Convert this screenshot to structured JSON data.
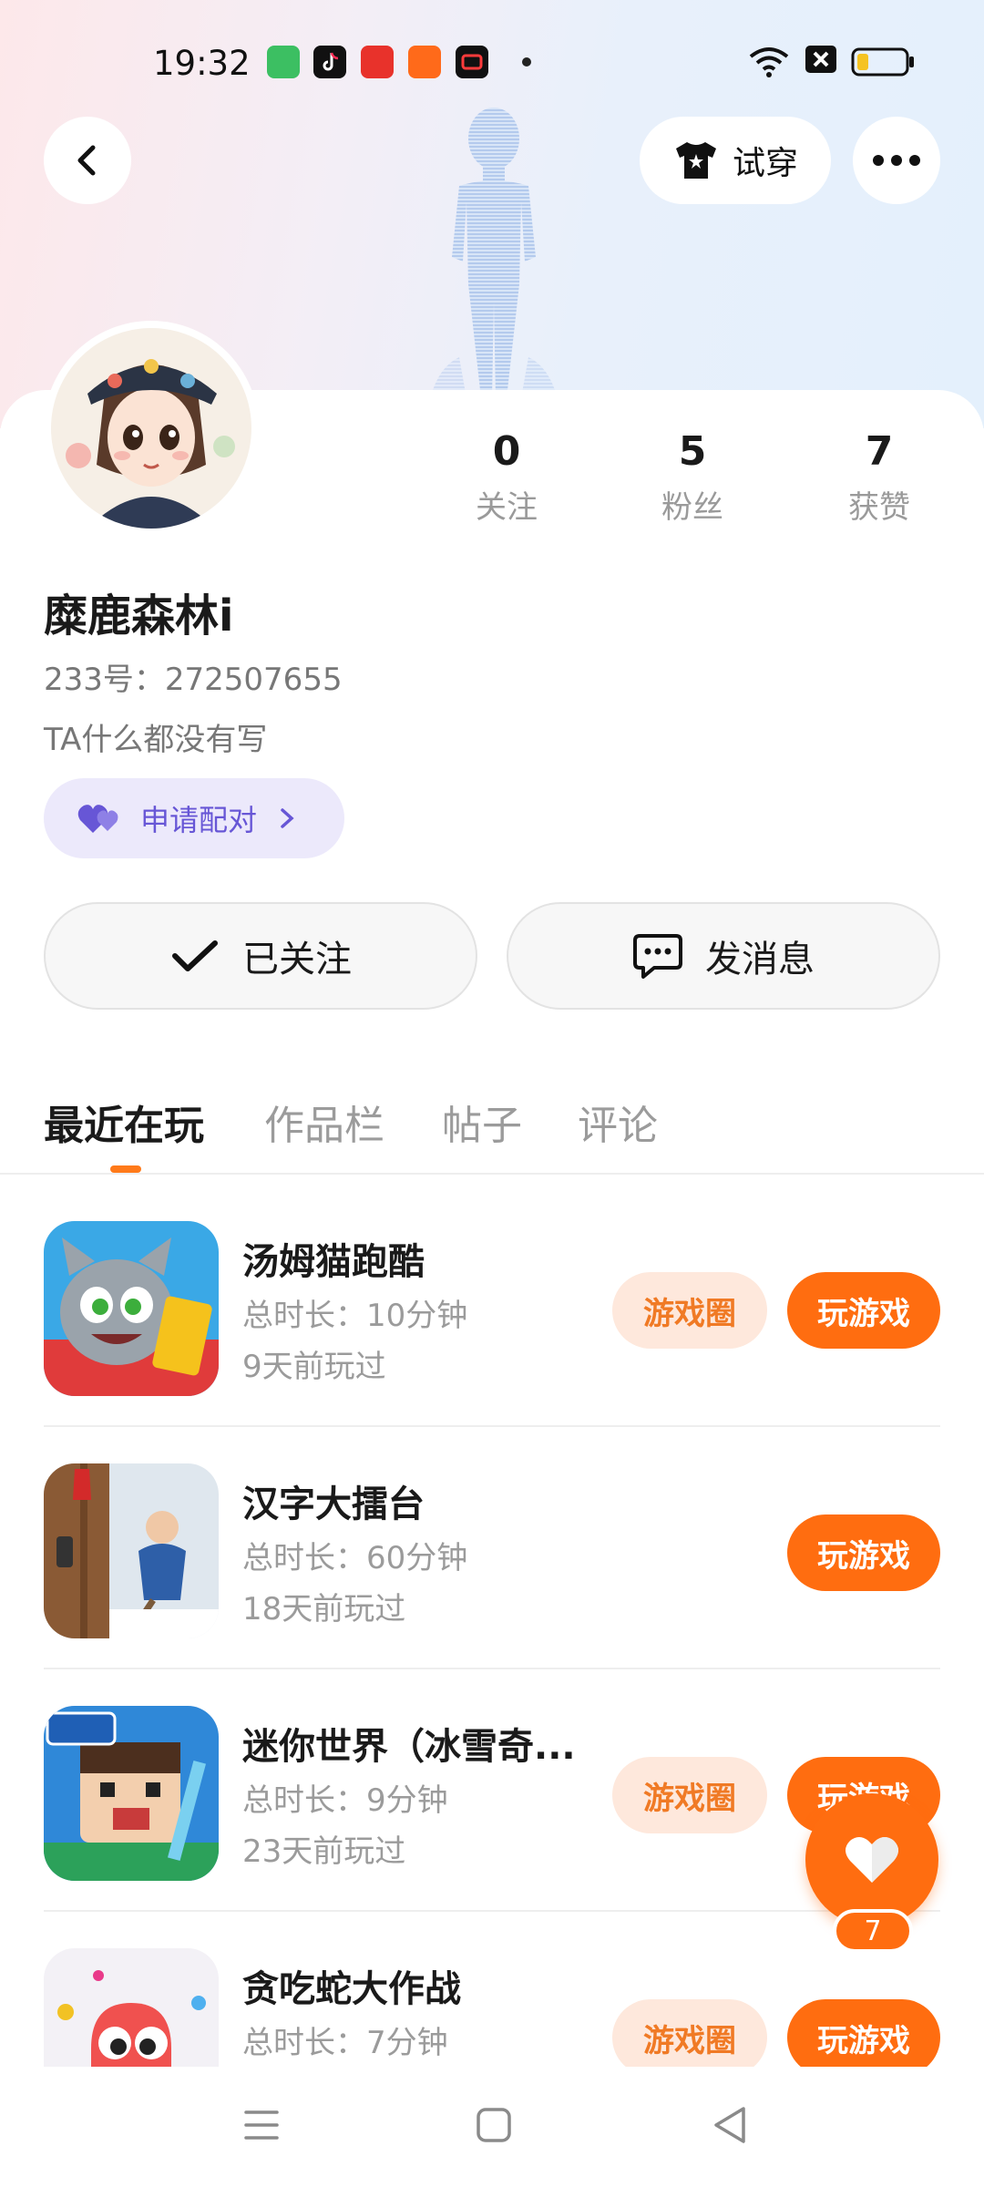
{
  "status_bar": {
    "time": "19:32",
    "app_icons": [
      "shop-app-icon",
      "tiktok-icon",
      "toutiao-icon",
      "kuaishou-icon",
      "record-icon"
    ],
    "indicators": [
      "wifi-icon",
      "sim-off-icon",
      "battery-icon"
    ]
  },
  "header": {
    "tryon_label": "试穿",
    "colors": {
      "background_left": "#fde8ea",
      "background_right": "#e4f0fc"
    }
  },
  "profile": {
    "username": "糜鹿森林i",
    "id_line": "233号：272507655",
    "bio": "TA什么都没有写",
    "pair_label": "申请配对",
    "stats": [
      {
        "value": "0",
        "label": "关注"
      },
      {
        "value": "5",
        "label": "粉丝"
      },
      {
        "value": "7",
        "label": "获赞"
      }
    ]
  },
  "actions": {
    "follow_label": "已关注",
    "message_label": "发消息"
  },
  "tabs": [
    {
      "label": "最近在玩",
      "active": true
    },
    {
      "label": "作品栏",
      "active": false
    },
    {
      "label": "帖子",
      "active": false
    },
    {
      "label": "评论",
      "active": false
    }
  ],
  "games": [
    {
      "name": "汤姆猫跑酷",
      "duration": "总时长：10分钟",
      "last_played": "9天前玩过",
      "circle_label": "游戏圈",
      "play_label": "玩游戏",
      "has_circle": true
    },
    {
      "name": "汉字大擂台",
      "duration": "总时长：60分钟",
      "last_played": "18天前玩过",
      "circle_label": "",
      "play_label": "玩游戏",
      "has_circle": false
    },
    {
      "name": "迷你世界（冰雪奇...",
      "duration": "总时长：9分钟",
      "last_played": "23天前玩过",
      "circle_label": "游戏圈",
      "play_label": "玩游戏",
      "has_circle": true
    },
    {
      "name": "贪吃蛇大作战",
      "duration": "总时长：7分钟",
      "last_played": "",
      "circle_label": "游戏圈",
      "play_label": "玩游戏",
      "has_circle": true
    }
  ],
  "like_fab": {
    "count": "7"
  },
  "colors": {
    "accent": "#ff6d10",
    "pair_bg": "#ece9fb",
    "pair_text": "#6756d6"
  }
}
